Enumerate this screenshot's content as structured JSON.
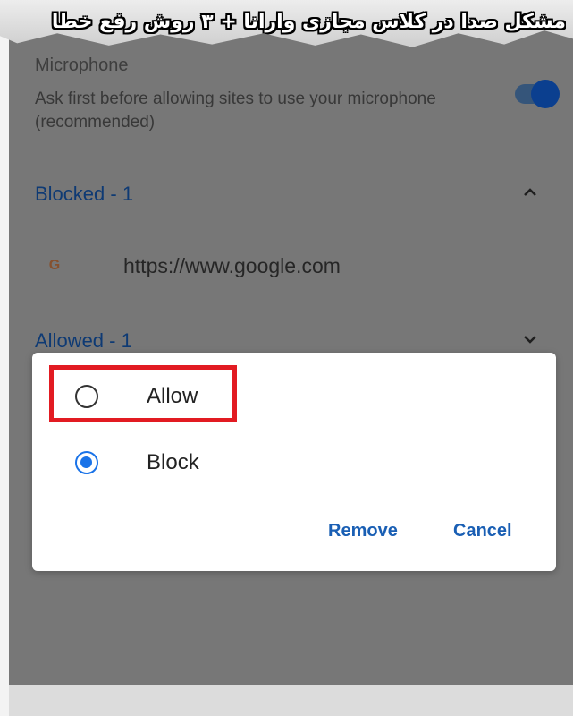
{
  "banner": {
    "title": "مشکل صدا در کلاس مجازی وارانا + ۳ روش رفع خطا"
  },
  "settings": {
    "microphone_title": "Microphone",
    "microphone_description": "Ask first before allowing sites to use your microphone (recommended)",
    "microphone_toggle_on": true,
    "blocked_label": "Blocked - 1",
    "blocked_site_url": "https://www.google.com",
    "site_icon_letter": "G",
    "allowed_label": "Allowed - 1"
  },
  "dialog": {
    "options": [
      {
        "label": "Allow",
        "selected": false
      },
      {
        "label": "Block",
        "selected": true
      }
    ],
    "remove_label": "Remove",
    "cancel_label": "Cancel"
  },
  "colors": {
    "accent": "#1a73e8",
    "highlight": "#e21b22",
    "section_label": "#0e3a74"
  }
}
